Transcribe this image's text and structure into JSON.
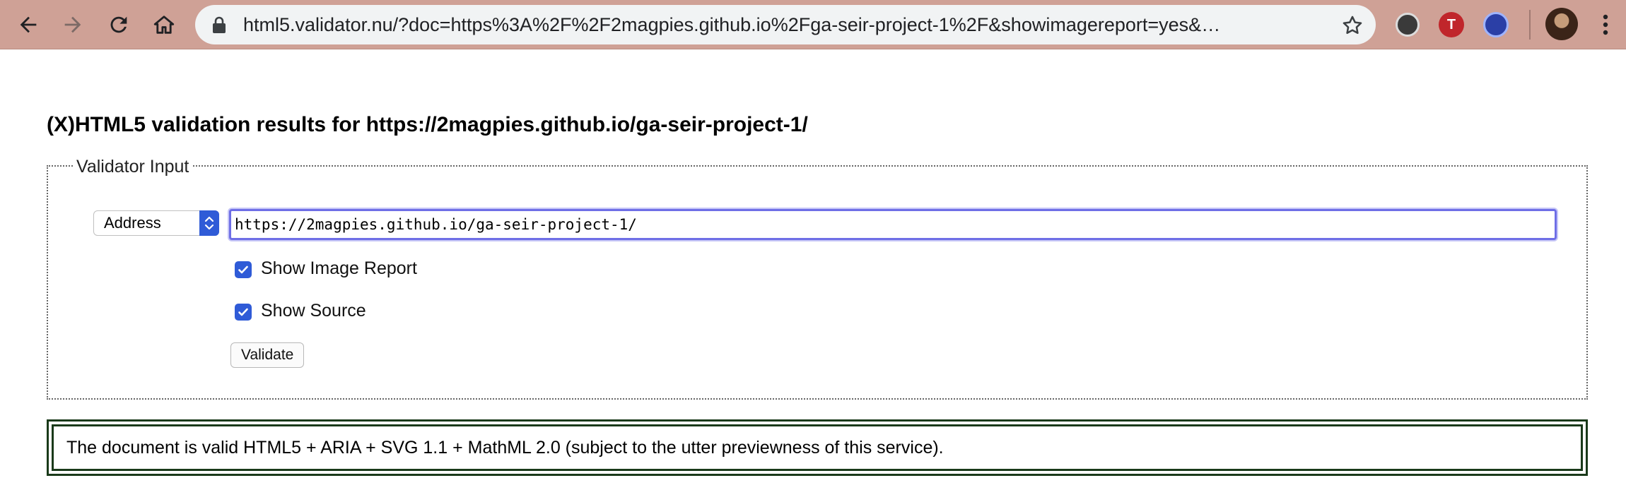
{
  "browser": {
    "url": "html5.validator.nu/?doc=https%3A%2F%2F2magpies.github.io%2Fga-seir-project-1%2F&showimagereport=yes&…",
    "icons": {
      "back": "back-arrow-icon",
      "forward": "forward-arrow-icon",
      "reload": "reload-icon",
      "home": "home-icon",
      "lock": "lock-icon",
      "bookmark": "star-icon",
      "menu": "kebab-menu-icon"
    },
    "extension_colors": [
      "#202124",
      "#c0262b",
      "#2b3fa6"
    ],
    "toolbar_color": "#cfa196"
  },
  "page": {
    "title": "(X)HTML5 validation results for https://2magpies.github.io/ga-seir-project-1/",
    "fieldset_legend": "Validator Input",
    "input_mode": "Address",
    "url_value": "https://2magpies.github.io/ga-seir-project-1/",
    "show_image_report_label": "Show Image Report",
    "show_image_report_checked": true,
    "show_source_label": "Show Source",
    "show_source_checked": true,
    "validate_label": "Validate",
    "result_message": "The document is valid HTML5 + ARIA + SVG 1.1 + MathML 2.0 (subject to the utter previewness of this service).",
    "accent_color": "#2f5bd7"
  }
}
